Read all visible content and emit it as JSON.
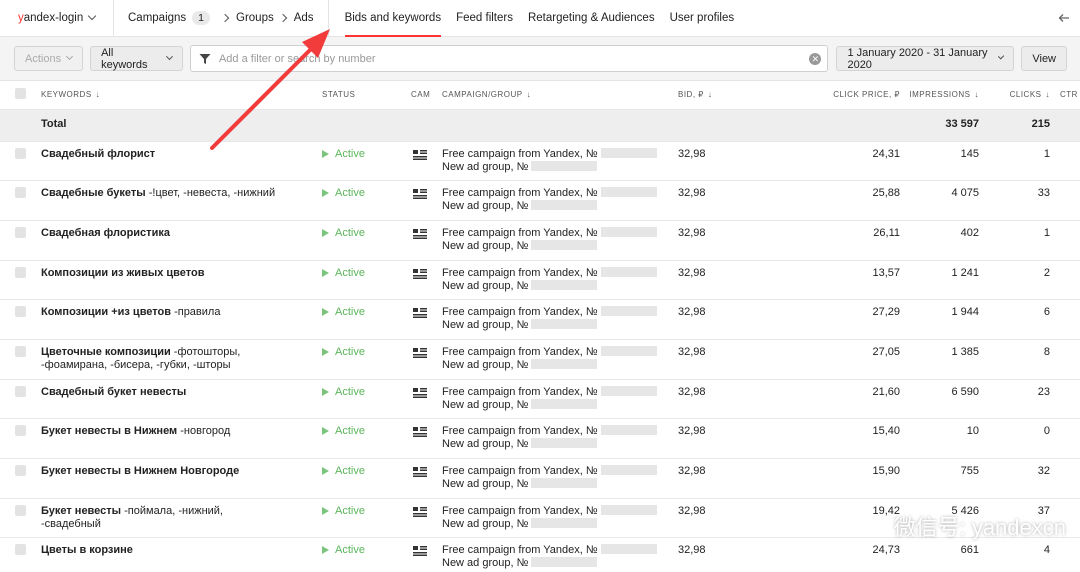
{
  "header": {
    "account_prefix": "y",
    "account_rest": "andex-login",
    "crumbs": {
      "campaigns": "Campaigns",
      "campaigns_count": "1",
      "groups": "Groups",
      "ads": "Ads"
    },
    "tabs": [
      "Bids and keywords",
      "Feed filters",
      "Retargeting & Audiences",
      "User profiles"
    ],
    "active_tab": "Bids and keywords"
  },
  "toolbar": {
    "actions": "Actions",
    "all_keywords": "All keywords",
    "filter_placeholder": "Add a filter or search by number",
    "date_range": "1 January 2020 - 31 January 2020",
    "view": "View"
  },
  "table": {
    "columns": {
      "keywords": "KEYWORDS",
      "status": "STATUS",
      "cam": "CAM",
      "campaign_group": "CAMPAIGN/GROUP",
      "bid": "BID, ₽",
      "click_price": "CLICK PRICE, ₽",
      "impressions": "IMPRESSIONS",
      "clicks": "CLICKS",
      "ctr": "CTR"
    },
    "total": {
      "label": "Total",
      "impressions": "33 597",
      "clicks": "215"
    },
    "rows": [
      {
        "kw": "Свадебный флорист",
        "kw2": "",
        "status": "Active",
        "camp": "Free campaign from Yandex, №",
        "group": "New ad group, №",
        "bid": "32,98",
        "price": "24,31",
        "impr": "145",
        "clicks": "1"
      },
      {
        "kw": "Свадебные букеты",
        "neg": " -!цвет, -невеста, -нижний",
        "kw2": "",
        "status": "Active",
        "camp": "Free campaign from Yandex, №",
        "group": "New ad group, №",
        "bid": "32,98",
        "price": "25,88",
        "impr": "4 075",
        "clicks": "33"
      },
      {
        "kw": "Свадебная флористика",
        "kw2": "",
        "status": "Active",
        "camp": "Free campaign from Yandex, №",
        "group": "New ad group, №",
        "bid": "32,98",
        "price": "26,11",
        "impr": "402",
        "clicks": "1"
      },
      {
        "kw": "Композиции из живых цветов",
        "kw2": "",
        "status": "Active",
        "camp": "Free campaign from Yandex, №",
        "group": "New ad group, №",
        "bid": "32,98",
        "price": "13,57",
        "impr": "1 241",
        "clicks": "2"
      },
      {
        "kw": "Композиции +из цветов",
        "neg": " -правила",
        "kw2": "",
        "status": "Active",
        "camp": "Free campaign from Yandex, №",
        "group": "New ad group, №",
        "bid": "32,98",
        "price": "27,29",
        "impr": "1 944",
        "clicks": "6"
      },
      {
        "kw": "Цветочные композиции",
        "neg": " -фотошторы,",
        "kw2": "-фоамирана, -бисера, -губки, -шторы",
        "status": "Active",
        "camp": "Free campaign from Yandex, №",
        "group": "New ad group, №",
        "bid": "32,98",
        "price": "27,05",
        "impr": "1 385",
        "clicks": "8"
      },
      {
        "kw": "Свадебный букет невесты",
        "kw2": "",
        "status": "Active",
        "camp": "Free campaign from Yandex, №",
        "group": "New ad group, №",
        "bid": "32,98",
        "price": "21,60",
        "impr": "6 590",
        "clicks": "23"
      },
      {
        "kw": "Букет невесты в Нижнем",
        "neg": " -новгород",
        "kw2": "",
        "status": "Active",
        "camp": "Free campaign from Yandex, №",
        "group": "New ad group, №",
        "bid": "32,98",
        "price": "15,40",
        "impr": "10",
        "clicks": "0"
      },
      {
        "kw": "Букет невесты в Нижнем Новгороде",
        "kw2": "",
        "status": "Active",
        "camp": "Free campaign from Yandex, №",
        "group": "New ad group, №",
        "bid": "32,98",
        "price": "15,90",
        "impr": "755",
        "clicks": "32"
      },
      {
        "kw": "Букет невесты",
        "neg": " -поймала, -нижний,",
        "kw2": "-свадебный",
        "status": "Active",
        "camp": "Free campaign from Yandex, №",
        "group": "New ad group, №",
        "bid": "32,98",
        "price": "19,42",
        "impr": "5 426",
        "clicks": "37"
      },
      {
        "kw": "Цветы в корзине",
        "kw2": "",
        "status": "Active",
        "camp": "Free campaign from Yandex, №",
        "group": "New ad group, №",
        "bid": "32,98",
        "price": "24,73",
        "impr": "661",
        "clicks": "4"
      }
    ]
  },
  "watermark": "微信号: yandexcn",
  "colors": {
    "accent": "#ff3333",
    "status_active": "#5ab55a"
  }
}
